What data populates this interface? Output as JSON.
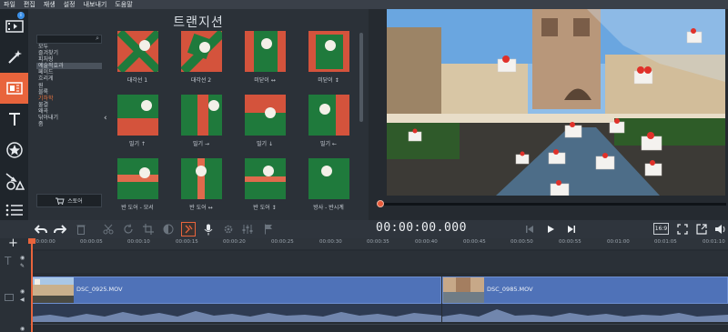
{
  "menu": [
    "파일",
    "편집",
    "재생",
    "설정",
    "내보내기",
    "도움말"
  ],
  "rail": {
    "badge": "i",
    "tools": [
      {
        "icon": "film-import-icon"
      },
      {
        "icon": "magic-wand-icon"
      },
      {
        "icon": "transitions-icon"
      },
      {
        "icon": "text-icon"
      },
      {
        "icon": "stickers-icon"
      },
      {
        "icon": "shapes-icon"
      },
      {
        "icon": "more-list-icon"
      }
    ]
  },
  "panel": {
    "title": "트랜지션",
    "search_placeholder": "",
    "categories": [
      "모두",
      "즐겨찾기",
      "피처링",
      "예술적효과",
      "페이드",
      "흐리게",
      "원",
      "블록",
      "기하학",
      "물결",
      "왜곡",
      "닦아내기",
      "줌"
    ],
    "store_label": "스토어",
    "transitions": [
      {
        "label": "대각선 1"
      },
      {
        "label": "대각선 2"
      },
      {
        "label": "미닫이 ↔"
      },
      {
        "label": "미닫이 ↕"
      },
      {
        "label": "밀기 ↑"
      },
      {
        "label": "밀기 →"
      },
      {
        "label": "밀기 ↓"
      },
      {
        "label": "밀기 ←"
      },
      {
        "label": "반 도어 - 모서"
      },
      {
        "label": "반 도어 ↔"
      },
      {
        "label": "반 도어 ↕"
      },
      {
        "label": "방사 - 반시계"
      }
    ]
  },
  "player": {
    "timecode": "00:00:00.000",
    "aspect": "16:9",
    "progress": 0
  },
  "timeline": {
    "ruler": [
      "00:00:00",
      "00:00:05",
      "00:00:10",
      "00:00:15",
      "00:00:20",
      "00:00:25",
      "00:00:30",
      "00:00:35",
      "00:00:40",
      "00:00:45",
      "00:00:50",
      "00:00:55",
      "00:01:00",
      "00:01:05",
      "00:01:10"
    ],
    "clips": [
      {
        "name": "DSC_0925.MOV"
      },
      {
        "name": "DSC_0985.MOV"
      }
    ]
  },
  "colors": {
    "accent": "#e8643c",
    "clip": "#4f72b8",
    "panel": "#2b3138"
  }
}
